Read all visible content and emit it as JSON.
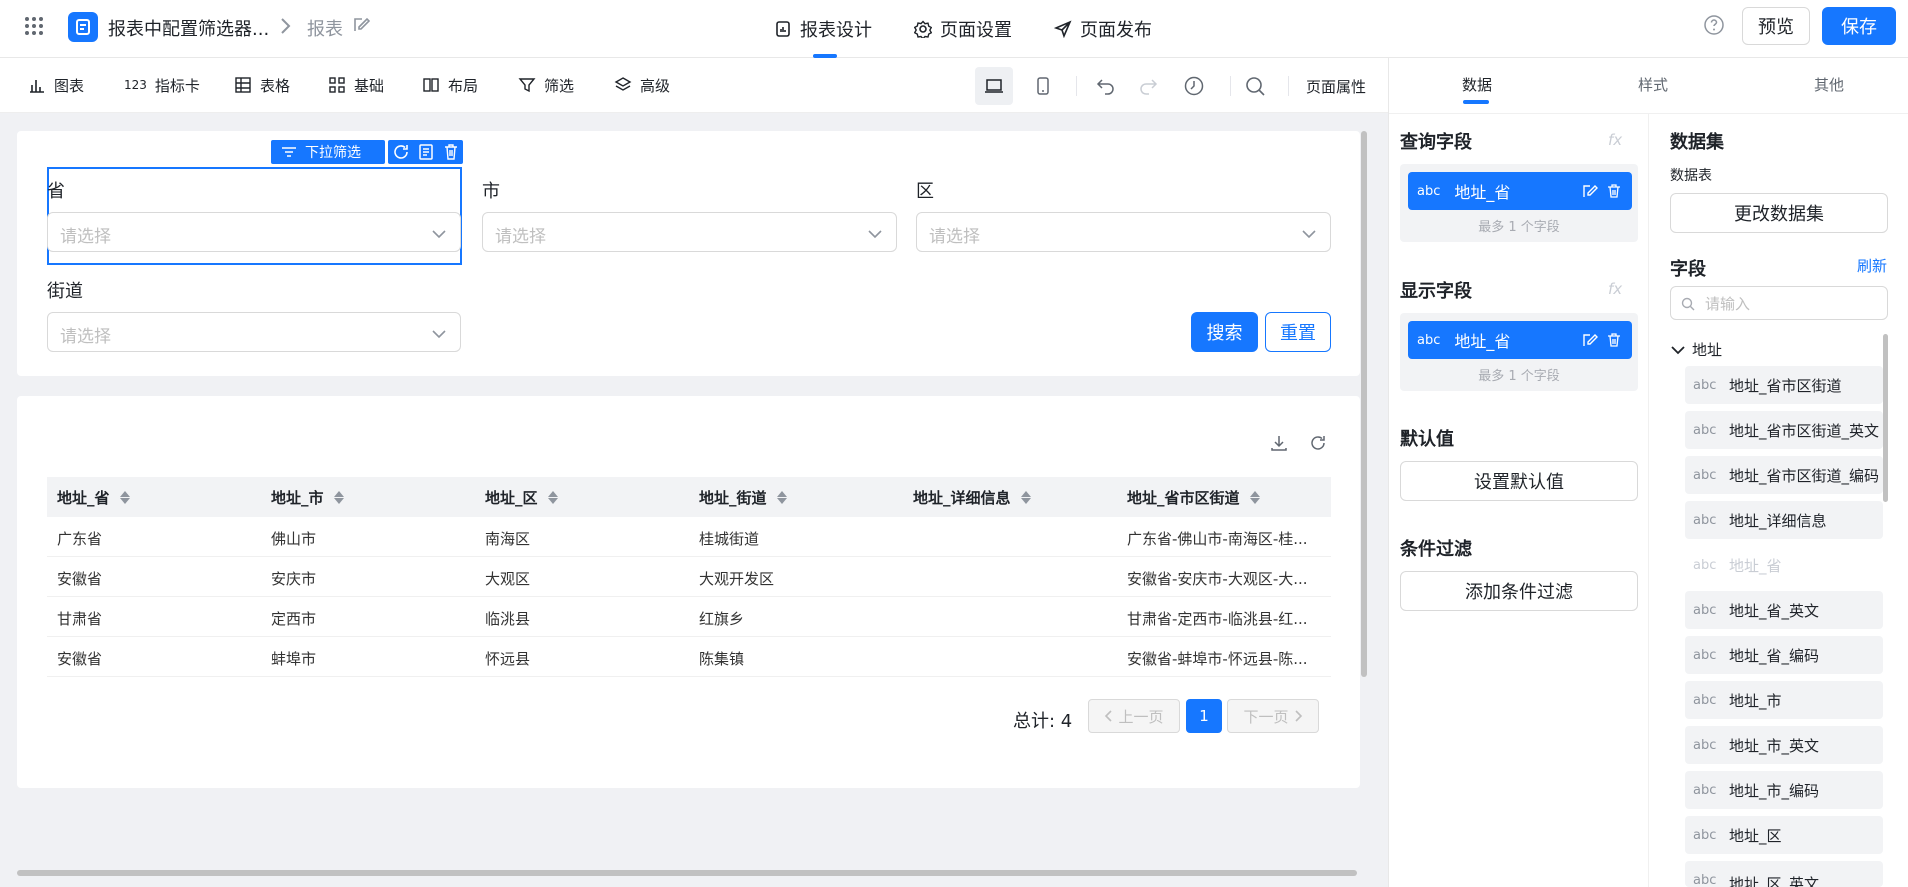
{
  "header": {
    "doc_title": "报表中配置筛选器...",
    "breadcrumb_current": "报表",
    "nav_tabs": [
      "报表设计",
      "页面设置",
      "页面发布"
    ],
    "preview_label": "预览",
    "save_label": "保存"
  },
  "toolbar": {
    "items": [
      "图表",
      "指标卡",
      "表格",
      "基础",
      "布局",
      "筛选",
      "高级"
    ],
    "page_props_label": "页面属性"
  },
  "filter": {
    "selected_tag": "下拉筛选",
    "fields": [
      {
        "label": "省",
        "placeholder": "请选择"
      },
      {
        "label": "市",
        "placeholder": "请选择"
      },
      {
        "label": "区",
        "placeholder": "请选择"
      },
      {
        "label": "街道",
        "placeholder": "请选择"
      }
    ],
    "search_label": "搜索",
    "reset_label": "重置"
  },
  "table": {
    "columns": [
      "地址_省",
      "地址_市",
      "地址_区",
      "地址_街道",
      "地址_详细信息",
      "地址_省市区街道"
    ],
    "rows": [
      [
        "广东省",
        "佛山市",
        "南海区",
        "桂城街道",
        "",
        "广东省-佛山市-南海区-桂..."
      ],
      [
        "安徽省",
        "安庆市",
        "大观区",
        "大观开发区",
        "",
        "安徽省-安庆市-大观区-大..."
      ],
      [
        "甘肃省",
        "定西市",
        "临洮县",
        "红旗乡",
        "",
        "甘肃省-定西市-临洮县-红..."
      ],
      [
        "安徽省",
        "蚌埠市",
        "怀远县",
        "陈集镇",
        "",
        "安徽省-蚌埠市-怀远县-陈..."
      ]
    ],
    "total_text": "总计: 4",
    "prev_label": "上一页",
    "next_label": "下一页",
    "current_page": "1"
  },
  "rpanel": {
    "tabs": [
      "数据",
      "样式",
      "其他"
    ],
    "query_title": "查询字段",
    "query_field": "地址_省",
    "query_hint": "最多 1 个字段",
    "display_title": "显示字段",
    "display_field": "地址_省",
    "display_hint": "最多 1 个字段",
    "fx_label": "fx",
    "default_title": "默认值",
    "default_btn": "设置默认值",
    "cond_title": "条件过滤",
    "cond_btn": "添加条件过滤",
    "abc": "abc"
  },
  "dataset": {
    "title": "数据集",
    "subtitle": "数据表",
    "change_btn": "更改数据集",
    "fields_title": "字段",
    "refresh_label": "刷新",
    "search_placeholder": "请输入",
    "group_label": "地址",
    "fields": [
      {
        "name": "地址_省市区街道",
        "disabled": false
      },
      {
        "name": "地址_省市区街道_英文",
        "disabled": false
      },
      {
        "name": "地址_省市区街道_编码",
        "disabled": false
      },
      {
        "name": "地址_详细信息",
        "disabled": false
      },
      {
        "name": "地址_省",
        "disabled": true
      },
      {
        "name": "地址_省_英文",
        "disabled": false
      },
      {
        "name": "地址_省_编码",
        "disabled": false
      },
      {
        "name": "地址_市",
        "disabled": false
      },
      {
        "name": "地址_市_英文",
        "disabled": false
      },
      {
        "name": "地址_市_编码",
        "disabled": false
      },
      {
        "name": "地址_区",
        "disabled": false
      },
      {
        "name": "地址_区_英文",
        "disabled": false
      }
    ]
  },
  "colors": {
    "primary": "#1677ff",
    "canvas_bg": "#f0f1f4"
  }
}
